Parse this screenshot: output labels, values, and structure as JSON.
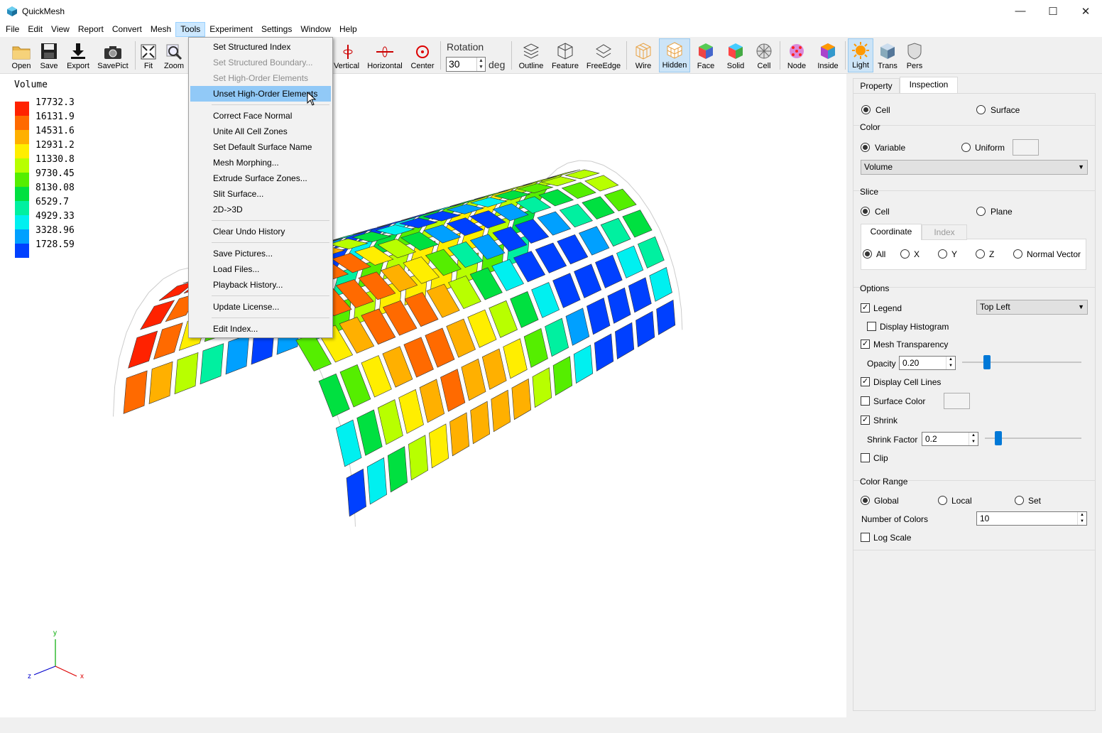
{
  "window": {
    "title": "QuickMesh",
    "minimize": "—",
    "maximize": "☐",
    "close": "✕"
  },
  "menubar": [
    "File",
    "Edit",
    "View",
    "Report",
    "Convert",
    "Mesh",
    "Tools",
    "Experiment",
    "Settings",
    "Window",
    "Help"
  ],
  "toolbar": {
    "open": "Open",
    "save": "Save",
    "export": "Export",
    "savepict": "SavePict",
    "fit": "Fit",
    "zoom": "Zoom",
    "vertical": "Vertical",
    "horizontal": "Horizontal",
    "center": "Center",
    "rotation_label": "Rotation",
    "rotation_value": "30",
    "rotation_unit": "deg",
    "outline": "Outline",
    "feature": "Feature",
    "freeedge": "FreeEdge",
    "wire": "Wire",
    "hidden": "Hidden",
    "face": "Face",
    "solid": "Solid",
    "cell": "Cell",
    "node": "Node",
    "inside": "Inside",
    "light": "Light",
    "trans": "Trans",
    "pers": "Pers"
  },
  "tools_menu": [
    {
      "label": "Set Structured Index",
      "disabled": false
    },
    {
      "label": "Set Structured Boundary...",
      "disabled": true
    },
    {
      "label": "Set High-Order Elements",
      "disabled": true
    },
    {
      "label": "Unset High-Order Elements",
      "disabled": false,
      "hover": true
    },
    {
      "label": "Correct Face Normal",
      "disabled": false
    },
    {
      "label": "Unite All Cell Zones",
      "disabled": false
    },
    {
      "label": "Set Default Surface Name",
      "disabled": false
    },
    {
      "label": "Mesh Morphing...",
      "disabled": false
    },
    {
      "label": "Extrude Surface Zones...",
      "disabled": false
    },
    {
      "label": "Slit Surface...",
      "disabled": false
    },
    {
      "label": "2D->3D",
      "disabled": false
    },
    {
      "label": "Clear Undo History",
      "disabled": false
    },
    {
      "label": "Save Pictures...",
      "disabled": false
    },
    {
      "label": "Load Files...",
      "disabled": false
    },
    {
      "label": "Playback History...",
      "disabled": false
    },
    {
      "label": "Update License...",
      "disabled": false
    },
    {
      "label": "Edit Index...",
      "disabled": false
    }
  ],
  "legend": {
    "title": "Volume",
    "values": [
      "17732.3",
      "16131.9",
      "14531.6",
      "12931.2",
      "11330.8",
      "9730.45",
      "8130.08",
      "6529.7",
      "4929.33",
      "3328.96",
      "1728.59"
    ],
    "colors": [
      "#ff2200",
      "#ff6a00",
      "#ffb000",
      "#ffee00",
      "#b8ff00",
      "#55ee00",
      "#00e040",
      "#00f0a0",
      "#00f0f0",
      "#00a0ff",
      "#0040ff"
    ]
  },
  "axes": {
    "x": "x",
    "y": "y",
    "z": "z"
  },
  "panel": {
    "tabs": [
      "Property",
      "Inspection"
    ],
    "cell": "Cell",
    "surface": "Surface",
    "color_group": "Color",
    "variable": "Variable",
    "uniform": "Uniform",
    "variable_select": "Volume",
    "slice_group": "Slice",
    "slice_cell": "Cell",
    "slice_plane": "Plane",
    "subtabs": [
      "Coordinate",
      "Index"
    ],
    "coord_all": "All",
    "coord_x": "X",
    "coord_y": "Y",
    "coord_z": "Z",
    "coord_normal": "Normal Vector",
    "options_group": "Options",
    "legend": "Legend",
    "legend_pos": "Top Left",
    "display_histogram": "Display Histogram",
    "mesh_transparency": "Mesh Transparency",
    "opacity_label": "Opacity",
    "opacity_value": "0.20",
    "display_cell_lines": "Display Cell Lines",
    "surface_color": "Surface Color",
    "shrink": "Shrink",
    "shrink_factor_label": "Shrink Factor",
    "shrink_factor_value": "0.2",
    "clip": "Clip",
    "color_range_group": "Color Range",
    "global": "Global",
    "local": "Local",
    "set": "Set",
    "num_colors_label": "Number of Colors",
    "num_colors_value": "10",
    "log_scale": "Log Scale"
  }
}
